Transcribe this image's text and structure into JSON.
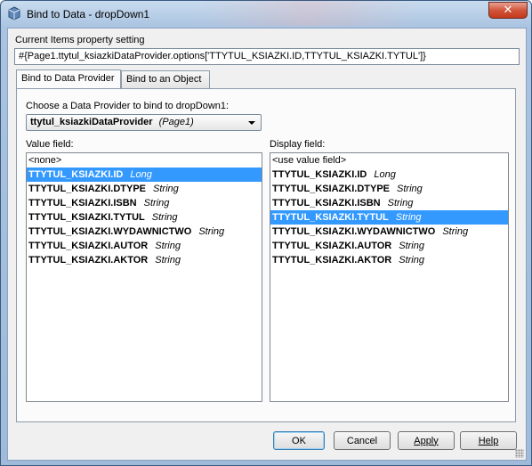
{
  "window": {
    "title": "Bind to Data - dropDown1",
    "close_label": "✕"
  },
  "property": {
    "label": "Current Items property setting",
    "value": "#{Page1.ttytul_ksiazkiDataProvider.options['TTYTUL_KSIAZKI.ID,TTYTUL_KSIAZKI.TYTUL']}"
  },
  "tabs": [
    {
      "label": "Bind to Data Provider",
      "active": true
    },
    {
      "label": "Bind to an Object",
      "active": false
    }
  ],
  "provider": {
    "label": "Choose a Data Provider to bind to dropDown1:",
    "selected_name": "ttytul_ksiazkiDataProvider",
    "selected_scope": "(Page1)"
  },
  "value_field": {
    "label": "Value field:",
    "items": [
      {
        "name": "<none>",
        "type": "",
        "bold": false,
        "selected": false
      },
      {
        "name": "TTYTUL_KSIAZKI.ID",
        "type": "Long",
        "bold": true,
        "selected": true
      },
      {
        "name": "TTYTUL_KSIAZKI.DTYPE",
        "type": "String",
        "bold": true,
        "selected": false
      },
      {
        "name": "TTYTUL_KSIAZKI.ISBN",
        "type": "String",
        "bold": true,
        "selected": false
      },
      {
        "name": "TTYTUL_KSIAZKI.TYTUL",
        "type": "String",
        "bold": true,
        "selected": false
      },
      {
        "name": "TTYTUL_KSIAZKI.WYDAWNICTWO",
        "type": "String",
        "bold": true,
        "selected": false
      },
      {
        "name": "TTYTUL_KSIAZKI.AUTOR",
        "type": "String",
        "bold": true,
        "selected": false
      },
      {
        "name": "TTYTUL_KSIAZKI.AKTOR",
        "type": "String",
        "bold": true,
        "selected": false
      }
    ]
  },
  "display_field": {
    "label": "Display field:",
    "items": [
      {
        "name": "<use value field>",
        "type": "",
        "bold": false,
        "selected": false
      },
      {
        "name": "TTYTUL_KSIAZKI.ID",
        "type": "Long",
        "bold": true,
        "selected": false
      },
      {
        "name": "TTYTUL_KSIAZKI.DTYPE",
        "type": "String",
        "bold": true,
        "selected": false
      },
      {
        "name": "TTYTUL_KSIAZKI.ISBN",
        "type": "String",
        "bold": true,
        "selected": false
      },
      {
        "name": "TTYTUL_KSIAZKI.TYTUL",
        "type": "String",
        "bold": true,
        "selected": true
      },
      {
        "name": "TTYTUL_KSIAZKI.WYDAWNICTWO",
        "type": "String",
        "bold": true,
        "selected": false
      },
      {
        "name": "TTYTUL_KSIAZKI.AUTOR",
        "type": "String",
        "bold": true,
        "selected": false
      },
      {
        "name": "TTYTUL_KSIAZKI.AKTOR",
        "type": "String",
        "bold": true,
        "selected": false
      }
    ]
  },
  "buttons": {
    "ok": "OK",
    "cancel": "Cancel",
    "apply": "Apply",
    "help": "Help"
  },
  "colors": {
    "selection": "#3399ff",
    "close_button": "#c2391c"
  }
}
